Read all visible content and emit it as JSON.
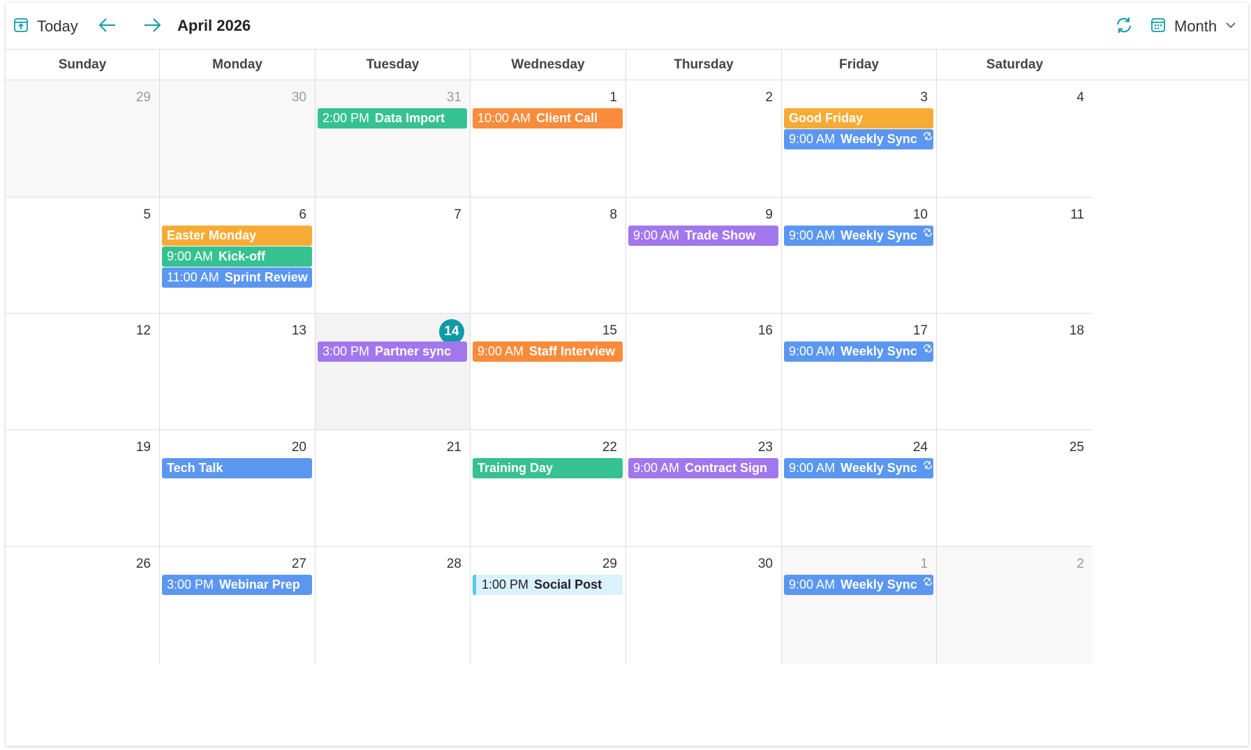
{
  "toolbar": {
    "today_label": "Today",
    "month_title": "April 2026",
    "view_label": "Month"
  },
  "colors": {
    "accent": "#0e9ba7",
    "green": "#36c290",
    "orange": "#f98b3a",
    "amber": "#f7ab35",
    "blue": "#5b97f0",
    "purple": "#a277ee",
    "light_blue": "#d9f2fb"
  },
  "weekdays": [
    "Sunday",
    "Monday",
    "Tuesday",
    "Wednesday",
    "Thursday",
    "Friday",
    "Saturday"
  ],
  "weeks": [
    [
      {
        "day": "29",
        "other": true,
        "events": []
      },
      {
        "day": "30",
        "other": true,
        "events": []
      },
      {
        "day": "31",
        "other": true,
        "events": [
          {
            "time": "2:00 PM",
            "title": "Data Import",
            "color": "green"
          }
        ]
      },
      {
        "day": "1",
        "events": [
          {
            "time": "10:00 AM",
            "title": "Client Call",
            "color": "orange"
          }
        ]
      },
      {
        "day": "2",
        "events": []
      },
      {
        "day": "3",
        "events": [
          {
            "time": "",
            "title": "Good Friday",
            "color": "amber"
          },
          {
            "time": "9:00 AM",
            "title": "Weekly Sync",
            "color": "blue",
            "recurring": true
          }
        ]
      },
      {
        "day": "4",
        "events": []
      }
    ],
    [
      {
        "day": "5",
        "events": []
      },
      {
        "day": "6",
        "events": [
          {
            "time": "",
            "title": "Easter Monday",
            "color": "amber"
          },
          {
            "time": "9:00 AM",
            "title": "Kick-off",
            "color": "green"
          },
          {
            "time": "11:00 AM",
            "title": "Sprint Review",
            "color": "blue",
            "recurring": true
          }
        ]
      },
      {
        "day": "7",
        "events": []
      },
      {
        "day": "8",
        "events": []
      },
      {
        "day": "9",
        "events": [
          {
            "time": "9:00 AM",
            "title": "Trade Show",
            "color": "purple"
          }
        ]
      },
      {
        "day": "10",
        "events": [
          {
            "time": "9:00 AM",
            "title": "Weekly Sync",
            "color": "blue",
            "recurring": true
          }
        ]
      },
      {
        "day": "11",
        "events": []
      }
    ],
    [
      {
        "day": "12",
        "events": []
      },
      {
        "day": "13",
        "events": []
      },
      {
        "day": "14",
        "today": true,
        "events": [
          {
            "time": "3:00 PM",
            "title": "Partner sync",
            "color": "purple"
          }
        ]
      },
      {
        "day": "15",
        "events": [
          {
            "time": "9:00 AM",
            "title": "Staff Interview",
            "color": "orange"
          }
        ]
      },
      {
        "day": "16",
        "events": []
      },
      {
        "day": "17",
        "events": [
          {
            "time": "9:00 AM",
            "title": "Weekly Sync",
            "color": "blue",
            "recurring": true
          }
        ]
      },
      {
        "day": "18",
        "events": []
      }
    ],
    [
      {
        "day": "19",
        "events": []
      },
      {
        "day": "20",
        "events": [
          {
            "time": "",
            "title": "Tech Talk",
            "color": "blue"
          }
        ]
      },
      {
        "day": "21",
        "events": []
      },
      {
        "day": "22",
        "events": [
          {
            "time": "",
            "title": "Training Day",
            "color": "green"
          }
        ]
      },
      {
        "day": "23",
        "events": [
          {
            "time": "9:00 AM",
            "title": "Contract Sign",
            "color": "purple"
          }
        ]
      },
      {
        "day": "24",
        "events": [
          {
            "time": "9:00 AM",
            "title": "Weekly Sync",
            "color": "blue",
            "recurring": true
          }
        ]
      },
      {
        "day": "25",
        "events": []
      }
    ],
    [
      {
        "day": "26",
        "events": []
      },
      {
        "day": "27",
        "events": [
          {
            "time": "3:00 PM",
            "title": "Webinar Prep",
            "color": "blue"
          }
        ]
      },
      {
        "day": "28",
        "events": []
      },
      {
        "day": "29",
        "events": [
          {
            "time": "1:00 PM",
            "title": "Social Post",
            "color": "light_blue",
            "light": true
          }
        ]
      },
      {
        "day": "30",
        "events": []
      },
      {
        "day": "1",
        "other": true,
        "events": [
          {
            "time": "9:00 AM",
            "title": "Weekly Sync",
            "color": "blue",
            "recurring": true
          }
        ]
      },
      {
        "day": "2",
        "other": true,
        "events": []
      }
    ]
  ]
}
